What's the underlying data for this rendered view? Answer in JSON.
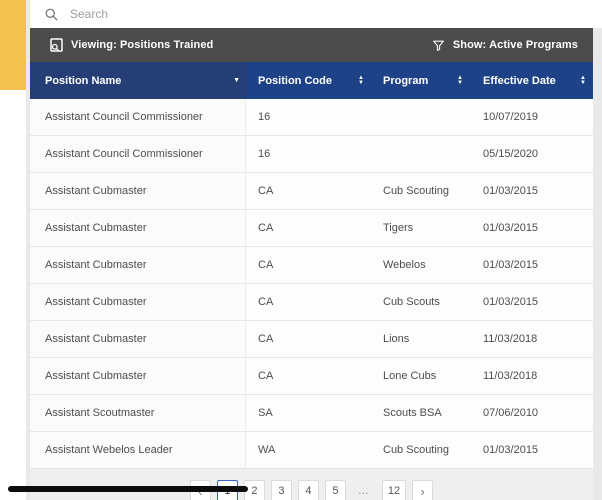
{
  "theme": {
    "yellow": "#F2C14E",
    "gutter": "#E9E9E9",
    "toolbar_bg": "#4B4B4B",
    "header_bg": "#1E4288",
    "header_bg_dark": "#253E75",
    "row_border": "#E6E6E6",
    "cell_text": "#4D4D4D",
    "placeholder": "#9E9E9E",
    "pagination_bg": "#EFEFEF",
    "btn_border": "#DBDBDB",
    "current_border": "#3D5FC9"
  },
  "search": {
    "placeholder": "Search"
  },
  "toolbar": {
    "viewing_label": "Viewing: Positions Trained",
    "show_label": "Show: Active Programs"
  },
  "icons": {
    "sort_asc": "▲",
    "sort_desc": "▼"
  },
  "table": {
    "columns": [
      {
        "label": "Position Name",
        "sort": "desc"
      },
      {
        "label": "Position Code",
        "sort": "both"
      },
      {
        "label": "Program",
        "sort": "both"
      },
      {
        "label": "Effective Date",
        "sort": "both"
      }
    ],
    "rows": [
      [
        "Assistant Council Commissioner",
        "16",
        "",
        "10/07/2019"
      ],
      [
        "Assistant Council Commissioner",
        "16",
        "",
        "05/15/2020"
      ],
      [
        "Assistant Cubmaster",
        "CA",
        "Cub Scouting",
        "01/03/2015"
      ],
      [
        "Assistant Cubmaster",
        "CA",
        "Tigers",
        "01/03/2015"
      ],
      [
        "Assistant Cubmaster",
        "CA",
        "Webelos",
        "01/03/2015"
      ],
      [
        "Assistant Cubmaster",
        "CA",
        "Cub Scouts",
        "01/03/2015"
      ],
      [
        "Assistant Cubmaster",
        "CA",
        "Lions",
        "11/03/2018"
      ],
      [
        "Assistant Cubmaster",
        "CA",
        "Lone Cubs",
        "11/03/2018"
      ],
      [
        "Assistant Scoutmaster",
        "SA",
        "Scouts BSA",
        "07/06/2010"
      ],
      [
        "Assistant Webelos Leader",
        "WA",
        "Cub Scouting",
        "01/03/2015"
      ]
    ]
  },
  "pagination": {
    "prev": "‹",
    "next": "›",
    "pages": [
      "1",
      "2",
      "3",
      "4",
      "5",
      "…",
      "12"
    ],
    "current": "1",
    "ellipsis": "…"
  }
}
